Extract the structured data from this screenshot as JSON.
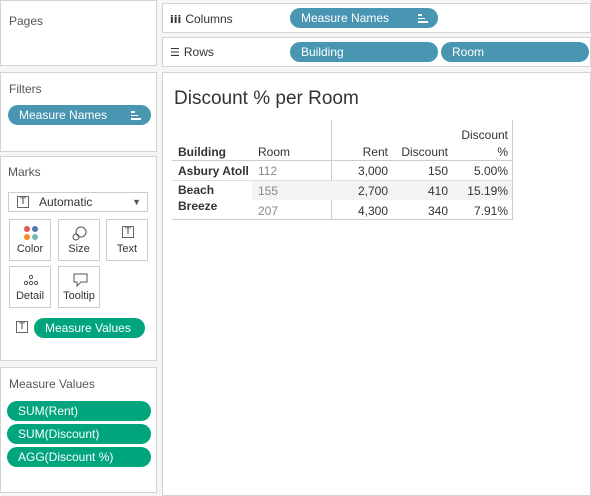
{
  "pages": {
    "title": "Pages"
  },
  "columns": {
    "label": "Columns",
    "pills": [
      "Measure Names"
    ]
  },
  "rows": {
    "label": "Rows",
    "pills": [
      "Building",
      "Room"
    ]
  },
  "filters": {
    "title": "Filters",
    "pills": [
      "Measure Names"
    ]
  },
  "marks": {
    "title": "Marks",
    "type": "Automatic",
    "buttons": {
      "color": "Color",
      "size": "Size",
      "text": "Text",
      "detail": "Detail",
      "tooltip": "Tooltip"
    },
    "text_pill": "Measure Values"
  },
  "measure_values": {
    "title": "Measure Values",
    "pills": [
      "SUM(Rent)",
      "SUM(Discount)",
      "AGG(Discount %)"
    ]
  },
  "sheet": {
    "title": "Discount % per Room",
    "headers": {
      "building": "Building",
      "room": "Room",
      "rent": "Rent",
      "discount": "Discount",
      "discount_pct_1": "Discount",
      "discount_pct_2": "%"
    },
    "rows": [
      {
        "building": "Asbury Atoll",
        "room": "112",
        "rent": "3,000",
        "discount": "150",
        "pct": "5.00%"
      },
      {
        "building": "Beach Breeze",
        "building_1": "Beach",
        "building_2": "Breeze",
        "room": "155",
        "rent": "2,700",
        "discount": "410",
        "pct": "15.19%"
      },
      {
        "building": "",
        "room": "207",
        "rent": "4,300",
        "discount": "340",
        "pct": "7.91%"
      }
    ]
  },
  "colors": {
    "blue_pill": "#4996b2",
    "green_pill": "#00a57d"
  }
}
